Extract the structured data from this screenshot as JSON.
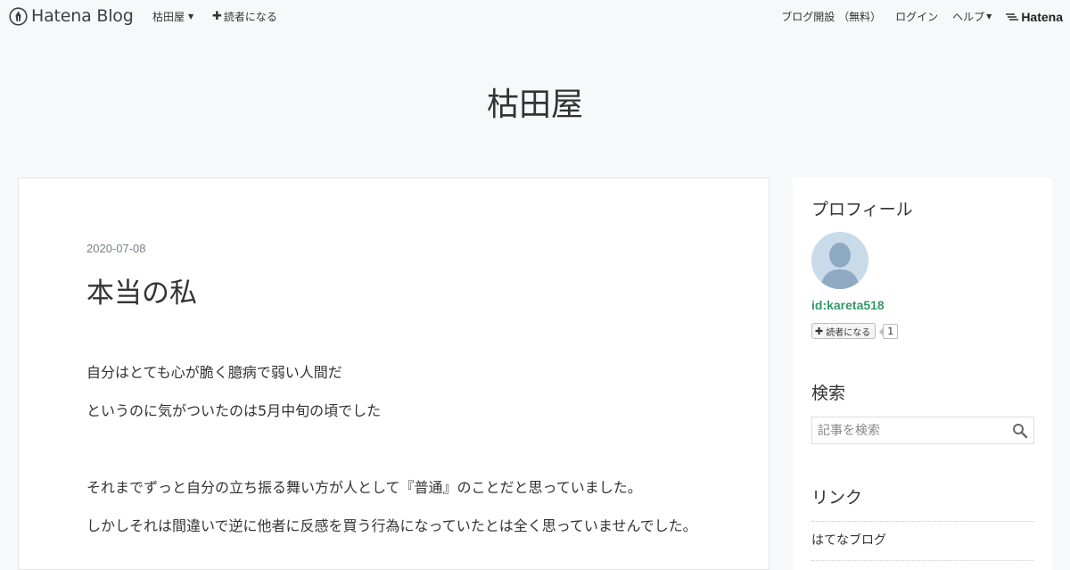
{
  "topbar": {
    "logo_text": "Hatena Blog",
    "blog_menu": "枯田屋",
    "subscribe": "読者になる",
    "open_blog": "ブログ開設 （無料）",
    "login": "ログイン",
    "help": "ヘルプ",
    "hatena": "Hatena"
  },
  "blog": {
    "title": "枯田屋"
  },
  "entry": {
    "date": "2020-07-08",
    "title": "本当の私",
    "paragraphs": [
      "自分はとても心が脆く臆病で弱い人間だ",
      "というのに気がついたのは5月中旬の頃でした",
      "それまでずっと自分の立ち振る舞い方が人として『普通』のことだと思っていました。",
      "しかしそれは間違いで逆に他者に反感を買う行為になっていたとは全く思っていませんでした。"
    ]
  },
  "sidebar": {
    "profile_heading": "プロフィール",
    "profile_id": "id:kareta518",
    "subscribe_label": "読者になる",
    "subscriber_count": "1",
    "search_heading": "検索",
    "search_placeholder": "記事を検索",
    "links_heading": "リンク",
    "links": [
      "はてなブログ"
    ]
  },
  "colors": {
    "accent_green": "#339966",
    "background": "#f7f8fa"
  }
}
